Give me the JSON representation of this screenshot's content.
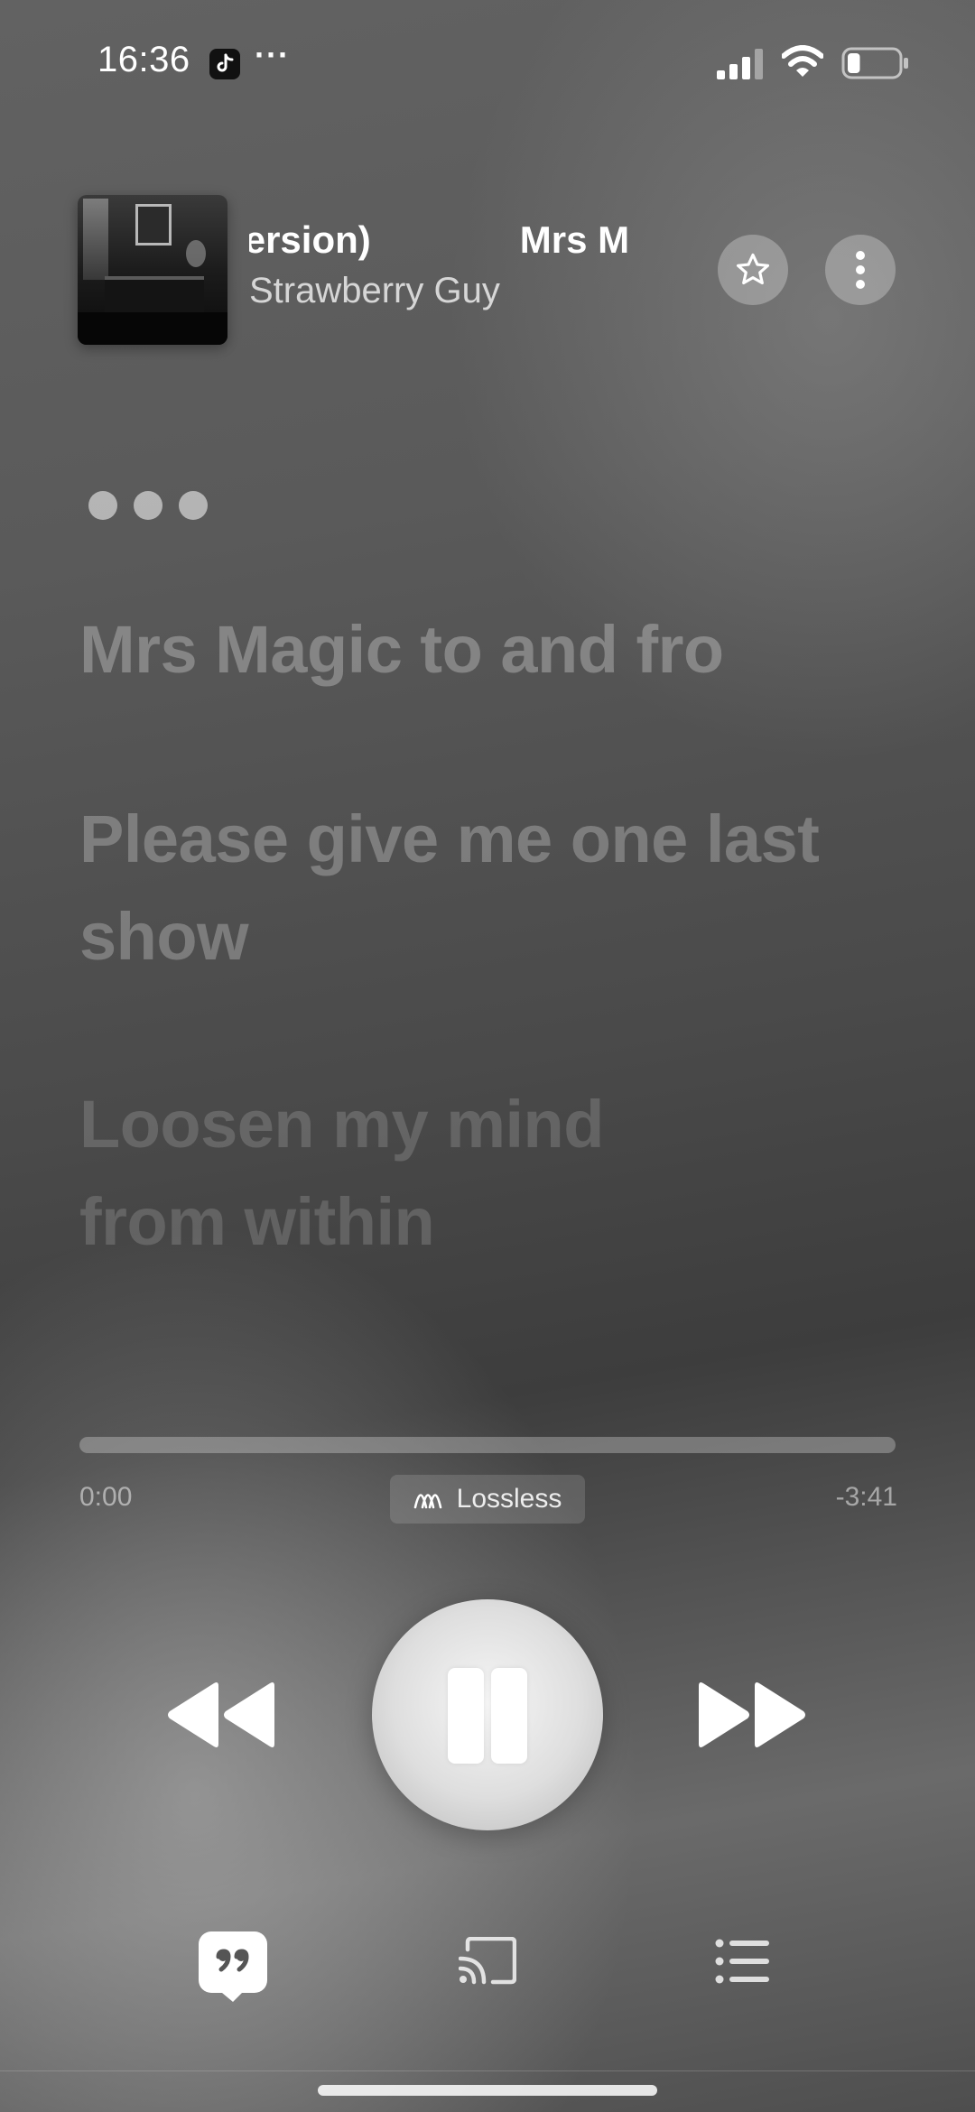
{
  "status_bar": {
    "time": "16:36",
    "more": "···",
    "icons": [
      "tiktok-icon",
      "signal-icon",
      "wifi-icon",
      "battery-icon"
    ],
    "battery_level": 0.25
  },
  "now_playing": {
    "title_fragment_start": "s Version)",
    "title_fragment_end": "Mrs M",
    "artist": "Strawberry Guy",
    "artwork_icon": "album-artwork",
    "actions": [
      "star-icon",
      "more-vertical-icon"
    ]
  },
  "lyrics": {
    "lines": [
      "Mrs Magic to and fro",
      "Please give me one last show",
      "Loosen my mind from within"
    ]
  },
  "playback": {
    "elapsed": "0:00",
    "remaining": "-3:41",
    "progress": 0.0,
    "quality_label": "Lossless",
    "quality_icon": "lossless-wave-icon"
  },
  "controls": {
    "icons": [
      "rewind-icon",
      "pause-icon",
      "fast-forward-icon"
    ]
  },
  "bottom_bar": {
    "icons": [
      "lyrics-icon",
      "airplay-cast-icon",
      "queue-list-icon"
    ]
  },
  "colors": {
    "text_primary": "#ffffff",
    "lyric_dim": "rgba(255,255,255,0.28)"
  }
}
